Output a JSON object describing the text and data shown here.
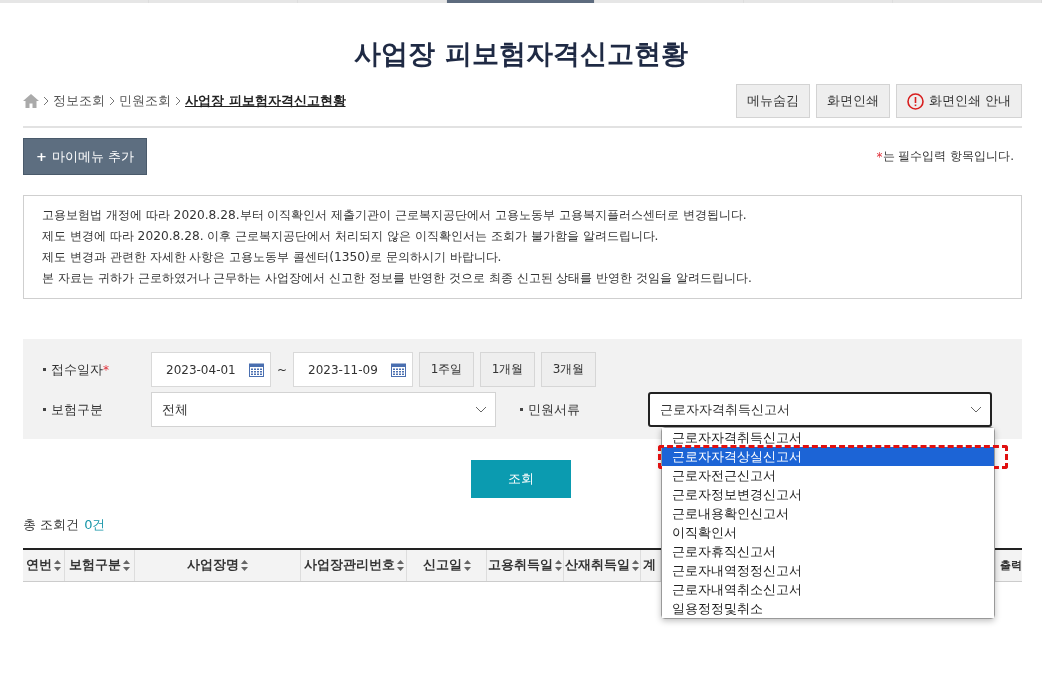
{
  "top_tabs": [
    {
      "selected": false
    },
    {
      "selected": false
    },
    {
      "selected": false
    },
    {
      "selected": true
    },
    {
      "selected": false
    },
    {
      "selected": false
    },
    {
      "selected": false
    }
  ],
  "title": "사업장 피보험자격신고현황",
  "breadcrumb": [
    "정보조회",
    "민원조회",
    "사업장 피보험자격신고현황"
  ],
  "header_buttons": [
    {
      "label": "메뉴숨김",
      "kind": "plain"
    },
    {
      "label": "화면인쇄",
      "kind": "plain"
    },
    {
      "label": "화면인쇄 안내",
      "kind": "alert"
    }
  ],
  "my_menu_icon": "+",
  "my_menu_button": "마이메뉴 추가",
  "required_mark": "*",
  "required_note": "는 필수입력 항목입니다.",
  "notice": [
    "고용보험법 개정에 따라 2020.8.28.부터 이직확인서 제출기관이 근로복지공단에서 고용노동부 고용복지플러스센터로 변경됩니다.",
    "제도 변경에 따라 2020.8.28. 이후 근로복지공단에서 처리되지 않은 이직확인서는 조회가 불가함을 알려드립니다.",
    "제도 변경과 관련한 자세한 사항은 고용노동부 콜센터(1350)로 문의하시기 바랍니다.",
    "본 자료는 귀하가 근로하였거나 근무하는 사업장에서 신고한 정보를 반영한 것으로 최종 신고된 상태를 반영한 것임을 알려드립니다."
  ],
  "search": {
    "date_label": "접수일자",
    "required_mark": "*",
    "date_from": "2023-04-01",
    "tilde": "~",
    "date_to": "2023-11-09",
    "period_buttons": [
      "1주일",
      "1개월",
      "3개월"
    ],
    "insurance_label": "보험구분",
    "insurance_value": "전체",
    "document_label": "민원서류",
    "document_value": "근로자자격취득신고서",
    "document_options": [
      {
        "label": "근로자자격취득신고서",
        "selected": false
      },
      {
        "label": "근로자자격상실신고서",
        "selected": true
      },
      {
        "label": "근로자전근신고서",
        "selected": false
      },
      {
        "label": "근로자정보변경신고서",
        "selected": false
      },
      {
        "label": "근로내용확인신고서",
        "selected": false
      },
      {
        "label": "이직확인서",
        "selected": false
      },
      {
        "label": "근로자휴직신고서",
        "selected": false
      },
      {
        "label": "근로자내역정정신고서",
        "selected": false
      },
      {
        "label": "근로자내역취소신고서",
        "selected": false
      },
      {
        "label": "일용정정및취소",
        "selected": false
      }
    ]
  },
  "search_button": "조회",
  "total_label": "총 조회건",
  "total_count": "0건",
  "table": {
    "columns": [
      {
        "label": "연번",
        "sortable": true
      },
      {
        "label": "보험구분",
        "sortable": true
      },
      {
        "label": "사업장명",
        "sortable": true
      },
      {
        "label": "사업장관리번호",
        "sortable": true
      },
      {
        "label": "신고일",
        "sortable": true
      },
      {
        "label": "고용취득일",
        "sortable": true
      },
      {
        "label": "산재취득일",
        "sortable": true
      },
      {
        "label": "계",
        "sortable": false
      },
      {
        "label": "출력",
        "sortable": false
      }
    ]
  }
}
